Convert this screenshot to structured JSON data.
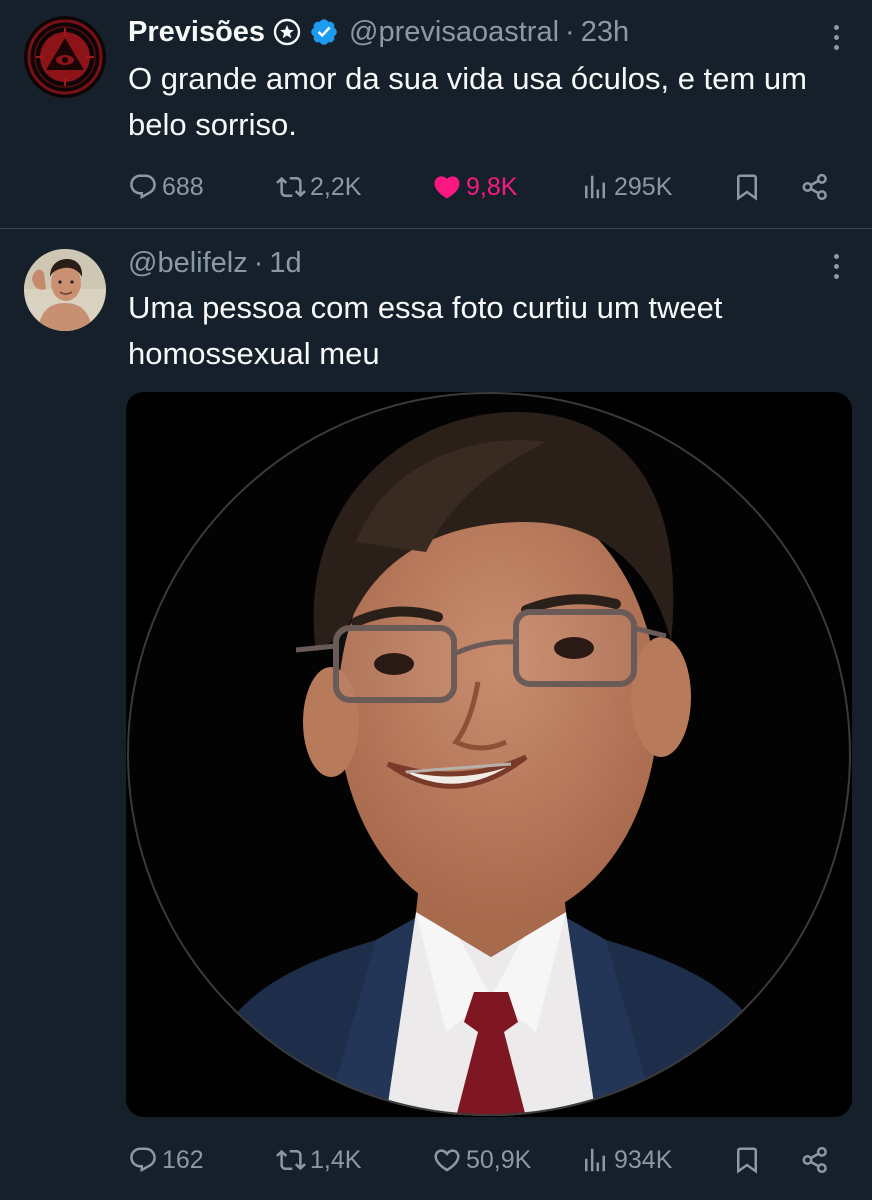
{
  "tweets": [
    {
      "display_name": "Previsões",
      "handle": "@previsaoastral",
      "separator": "·",
      "time": "23h",
      "text": "O grande amor da sua vida usa óculos, e tem um belo sorriso.",
      "stats": {
        "replies": "688",
        "retweets": "2,2K",
        "likes": "9,8K",
        "views": "295K"
      },
      "liked": true,
      "colors": {
        "like": "#f91880",
        "verified": "#1d9bf0"
      }
    },
    {
      "handle": "@belifelz",
      "separator": "·",
      "time": "1d",
      "text": "Uma pessoa com essa foto curtiu um tweet homossexual meu",
      "stats": {
        "replies": "162",
        "retweets": "1,4K",
        "likes": "50,9K",
        "views": "934K"
      },
      "liked": false
    }
  ],
  "theme": {
    "background": "#15202b",
    "divider": "#38444d",
    "text": "#f7f9f9",
    "muted": "#8b98a5"
  },
  "icons": [
    "reply-icon",
    "retweet-icon",
    "like-icon",
    "views-icon",
    "bookmark-icon",
    "share-icon",
    "more-icon",
    "verified-icon"
  ]
}
